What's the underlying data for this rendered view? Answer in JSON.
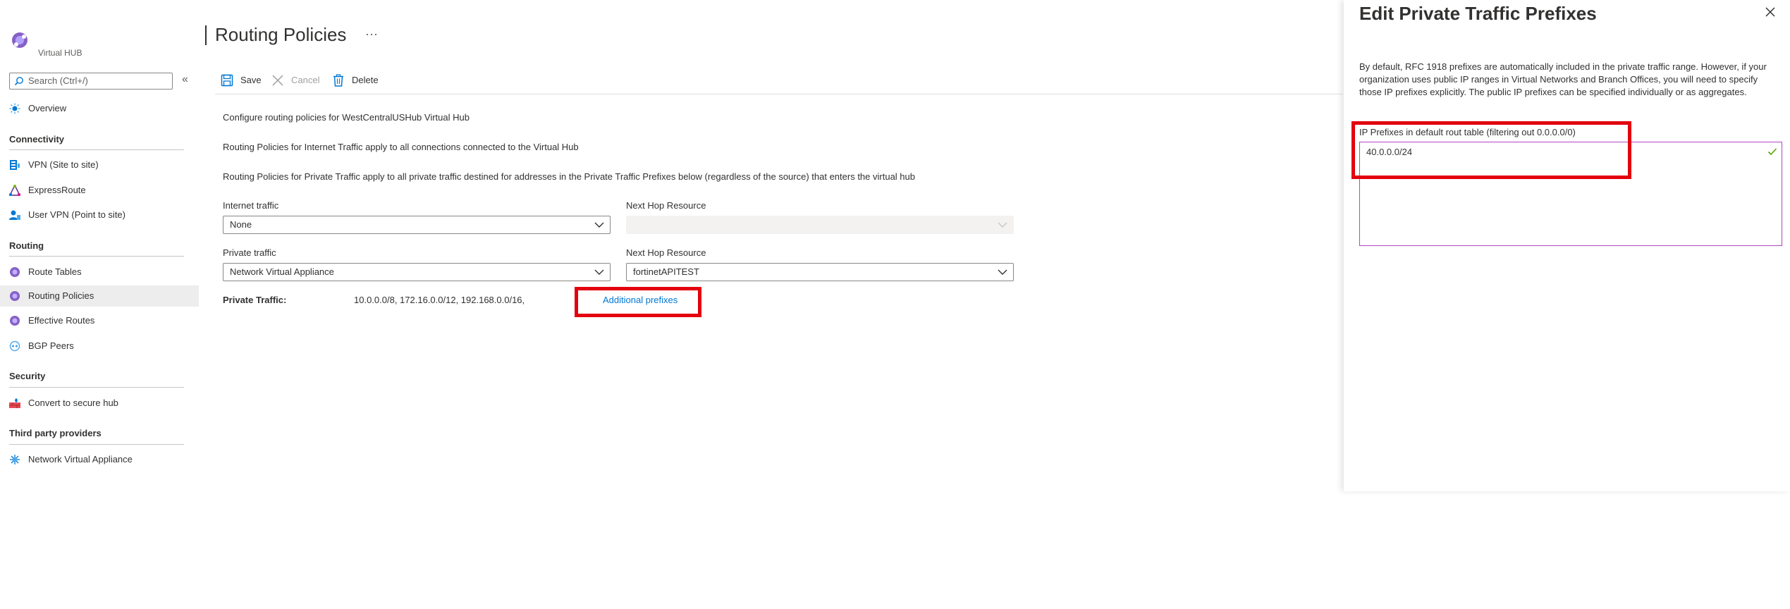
{
  "sidebar": {
    "hub_label": "Virtual HUB",
    "search_placeholder": "Search (Ctrl+/)",
    "collapse_glyph": "«",
    "overview": "Overview",
    "sections": {
      "connectivity": "Connectivity",
      "routing": "Routing",
      "security": "Security",
      "third_party": "Third party providers"
    },
    "items": {
      "vpn": "VPN (Site to site)",
      "expressroute": "ExpressRoute",
      "user_vpn": "User VPN (Point to site)",
      "route_tables": "Route Tables",
      "routing_policies": "Routing Policies",
      "effective_routes": "Effective Routes",
      "bgp_peers": "BGP Peers",
      "convert_secure": "Convert to secure hub",
      "nva": "Network Virtual Appliance"
    },
    "selected": "routing_policies"
  },
  "main": {
    "title": "Routing Policies",
    "more": "···",
    "toolbar": {
      "save": "Save",
      "cancel": "Cancel",
      "delete": "Delete"
    },
    "descriptions": [
      "Configure routing policies for WestCentralUSHub Virtual Hub",
      "Routing Policies for Internet Traffic apply to all connections connected to the Virtual Hub",
      "Routing Policies for Private Traffic apply to all private traffic destined for addresses in the Private Traffic Prefixes below (regardless of the source) that enters the virtual hub"
    ],
    "internet_traffic": {
      "label": "Internet traffic",
      "value": "None",
      "next_hop_label": "Next Hop Resource",
      "next_hop_value": ""
    },
    "private_traffic": {
      "label": "Private traffic",
      "value": "Network Virtual Appliance",
      "next_hop_label": "Next Hop Resource",
      "next_hop_value": "fortinetAPITEST"
    },
    "private_summary": {
      "label": "Private Traffic:",
      "value": "10.0.0.0/8, 172.16.0.0/12, 192.168.0.0/16,",
      "link": "Additional prefixes"
    }
  },
  "panel": {
    "title": "Edit Private Traffic Prefixes",
    "description": "By default, RFC 1918 prefixes are automatically included in the private traffic range. However, if your organization uses public IP ranges in Virtual Networks and Branch Offices, you will need to specify those IP prefixes explicitly. The public IP prefixes can be specified individually or as aggregates.",
    "field_label": "IP Prefixes in default rout table (filtering out 0.0.0.0/0)",
    "field_value": "40.0.0.0/24"
  },
  "colors": {
    "accent": "#0078d4",
    "highlight": "#e3000f",
    "selected_bg": "#ededed",
    "textarea_border": "#b146c2",
    "check": "#57a300"
  },
  "icons": {
    "logo": "virtual-hub-icon",
    "search": "search-icon",
    "save": "save-icon",
    "cancel": "close-icon",
    "delete": "trash-icon",
    "close_panel": "close-icon",
    "dropdown": "chevron-down-icon",
    "valid": "checkmark-icon"
  }
}
